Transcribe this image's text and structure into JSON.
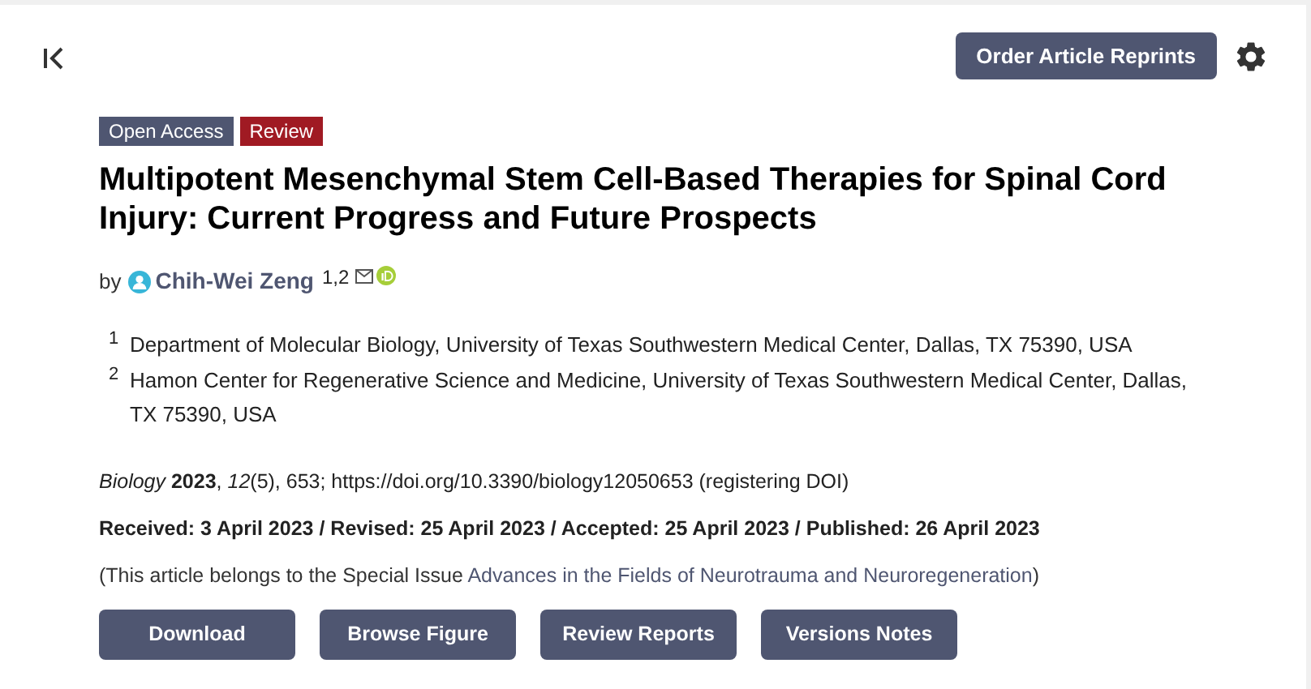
{
  "toolbar": {
    "order_button": "Order Article Reprints"
  },
  "badges": [
    {
      "label": "Open Access",
      "color": "#4f5671"
    },
    {
      "label": "Review",
      "color": "#a01a23"
    }
  ],
  "title": "Multipotent Mesenchymal Stem Cell-Based Therapies for Spinal Cord Injury: Current Progress and Future Prospects",
  "byline": {
    "prefix": "by",
    "author": "Chih-Wei Zeng",
    "affiliation_marks": "1,2"
  },
  "affiliations": [
    {
      "number": "1",
      "text": "Department of Molecular Biology, University of Texas Southwestern Medical Center, Dallas, TX 75390, USA"
    },
    {
      "number": "2",
      "text": "Hamon Center for Regenerative Science and Medicine, University of Texas Southwestern Medical Center, Dallas, TX 75390, USA"
    }
  ],
  "citation": "*Biology* **2023**, *12*(5), 653; https://doi.org/10.3390/biology12050653 (registering DOI)",
  "dates": "Received: 3 April 2023 / Revised: 25 April 2023 / Accepted: 25 April 2023 / Published: 26 April 2023",
  "special_issue": {
    "before": "(This article belongs to the Special Issue ",
    "link": "Advances in the Fields of Neurotrauma and Neuroregeneration",
    "after": ")"
  },
  "buttons": [
    "Download",
    "Browse Figure",
    "Review Reports",
    "Versions Notes"
  ]
}
